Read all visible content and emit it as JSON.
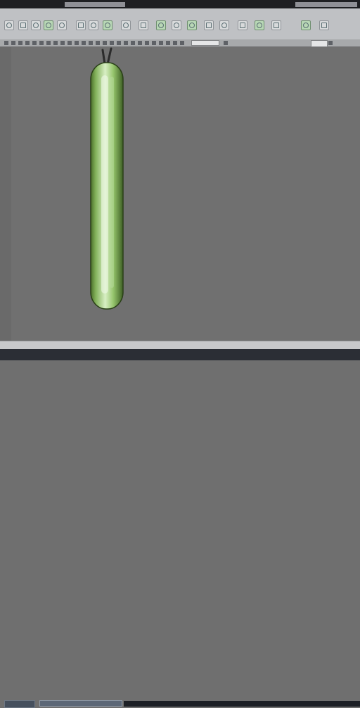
{
  "window": {
    "title_left": "",
    "title_right": ""
  },
  "toolbar": {
    "icons": [
      {
        "name": "tool-1-icon"
      },
      {
        "name": "tool-2-icon"
      },
      {
        "name": "tool-3-icon"
      },
      {
        "name": "tool-4-icon"
      },
      {
        "name": "tool-5-icon"
      },
      {
        "name": "tool-6-icon"
      },
      {
        "name": "tool-7-icon"
      },
      {
        "name": "tool-8-icon"
      },
      {
        "name": "tool-9-icon"
      },
      {
        "name": "tool-10-icon"
      },
      {
        "name": "tool-11-icon"
      },
      {
        "name": "tool-12-icon"
      },
      {
        "name": "tool-13-icon"
      },
      {
        "name": "tool-14-icon"
      },
      {
        "name": "tool-15-icon"
      },
      {
        "name": "tool-16-icon"
      },
      {
        "name": "tool-17-icon"
      },
      {
        "name": "tool-18-icon"
      },
      {
        "name": "tool-19-icon"
      },
      {
        "name": "tool-20-icon"
      }
    ]
  },
  "secondary_bar": {
    "field_value": ""
  },
  "canvas": {
    "background": "#707070",
    "object": "cucumber",
    "object_color": "#9ac46f"
  },
  "taskbar": {
    "task_label": ""
  }
}
